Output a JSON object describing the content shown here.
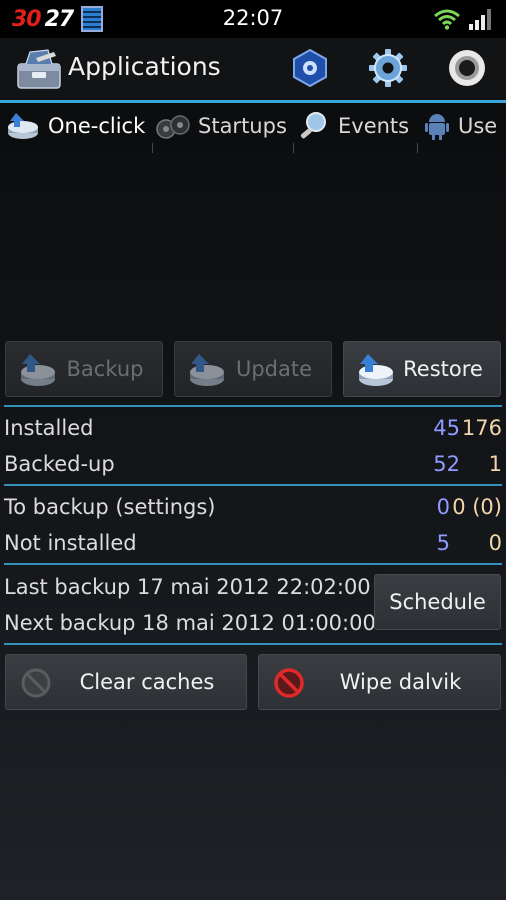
{
  "status_bar": {
    "temperature": "30",
    "notification_count": "27",
    "time": "22:07",
    "battery_icon": "battery-icon",
    "wifi_icon": "wifi-icon",
    "signal_icon": "signal-icon"
  },
  "action_bar": {
    "title": "Applications",
    "icons": [
      "toolbox-icon",
      "market-icon",
      "settings-gear-icon",
      "record-icon"
    ]
  },
  "tabs": [
    {
      "label": "One-click",
      "icon": "backup-disk-icon",
      "active": true
    },
    {
      "label": "Startups",
      "icon": "startup-icon",
      "active": false
    },
    {
      "label": "Events",
      "icon": "magnifier-icon",
      "active": false
    },
    {
      "label": "Use",
      "icon": "android-icon",
      "active": false
    }
  ],
  "actions": {
    "backup": {
      "label": "Backup",
      "enabled": false
    },
    "update": {
      "label": "Update",
      "enabled": false
    },
    "restore": {
      "label": "Restore",
      "enabled": true
    }
  },
  "stats": {
    "installed": {
      "label": "Installed",
      "user": "45",
      "system": "176"
    },
    "backed_up": {
      "label": "Backed-up",
      "user": "52",
      "system": "1"
    },
    "to_backup": {
      "label": "To backup (settings)",
      "user": "0",
      "system": "0 (0)"
    },
    "not_installed": {
      "label": "Not installed",
      "user": "5",
      "system": "0"
    }
  },
  "schedule": {
    "last_backup": "Last backup 17 mai 2012 22:02:00",
    "next_backup": "Next backup 18 mai 2012 01:00:00",
    "button_label": "Schedule"
  },
  "maintenance": {
    "clear_caches": "Clear caches",
    "wipe_dalvik": "Wipe dalvik"
  },
  "colors": {
    "accent": "#3aa7d8",
    "user_value": "#8f9bff",
    "system_value": "#f0d6a8",
    "battery_text": "#e0201a"
  }
}
